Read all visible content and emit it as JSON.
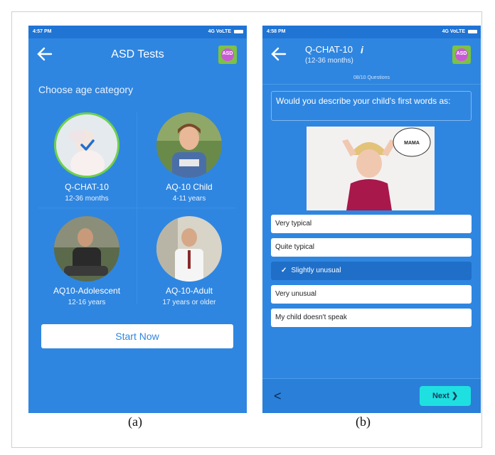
{
  "figure": {
    "caption_a": "(a)",
    "caption_b": "(b)"
  },
  "screen_a": {
    "status_time": "4:57 PM",
    "status_right": "4G VoLTE",
    "title": "ASD Tests",
    "logo_text": "ASD",
    "prompt": "Choose age category",
    "categories": [
      {
        "name": "Q-CHAT-10",
        "age": "12-36 months",
        "selected": true
      },
      {
        "name": "AQ-10 Child",
        "age": "4-11 years",
        "selected": false
      },
      {
        "name": "AQ10-Adolescent",
        "age": "12-16 years",
        "selected": false
      },
      {
        "name": "AQ-10-Adult",
        "age": "17 years or older",
        "selected": false
      }
    ],
    "start_label": "Start Now"
  },
  "screen_b": {
    "status_time": "4:58 PM",
    "status_right": "4G VoLTE",
    "title": "Q-CHAT-10",
    "subtitle": "(12-36 months)",
    "info_icon": "i",
    "logo_text": "ASD",
    "question_count": "08/10 Questions",
    "question": "Would you describe your child's first words as:",
    "speech_bubble": "MAMA",
    "options": [
      "Very typical",
      "Quite typical",
      "Slightly unusual",
      "Very unusual",
      "My child doesn't speak"
    ],
    "selected_option": "Slightly unusual",
    "prev_label": "<",
    "next_label": "Next"
  },
  "colors": {
    "primary": "#2f86e0",
    "selected_ring": "#6fd14a",
    "next_button": "#1fe0e0"
  }
}
